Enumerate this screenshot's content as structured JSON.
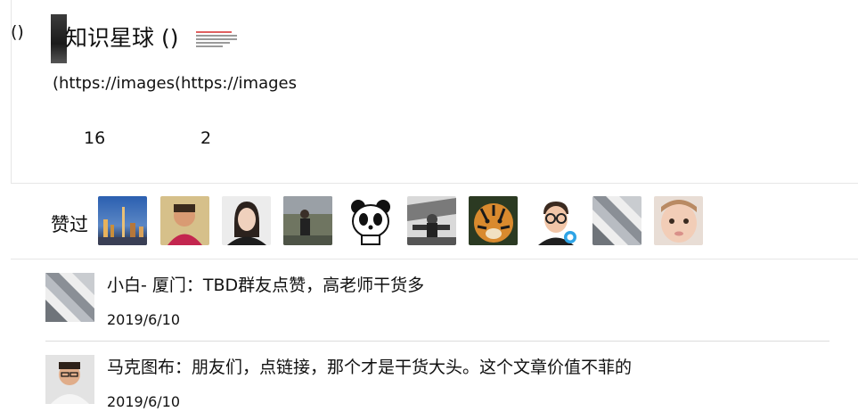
{
  "post": {
    "left_paren": "()",
    "title": "知识星球 ()",
    "links": [
      "(https://images",
      "(https://images"
    ],
    "stats": [
      "16",
      "2"
    ]
  },
  "likes": {
    "label": "赞过",
    "avatars": [
      "city-night-avatar",
      "man-portrait-avatar",
      "woman-portrait-avatar",
      "outdoor-person-avatar",
      "panda-avatar",
      "bw-cafe-avatar",
      "tiger-avatar",
      "cartoon-glasses-avatar",
      "laptop-avatar",
      "baby-avatar"
    ]
  },
  "comments": [
    {
      "author_text": "小白- 厦门：TBD群友点赞，高老师干货多",
      "date": "2019/6/10",
      "avatar": "laptop-avatar"
    },
    {
      "author_text": "马克图布：朋友们，点链接，那个才是干货大头。这个文章价值不菲的",
      "date": "2019/6/10",
      "avatar": "man-portrait-avatar"
    }
  ],
  "colors": {
    "divider": "#e6e6e6",
    "text": "#111111"
  }
}
